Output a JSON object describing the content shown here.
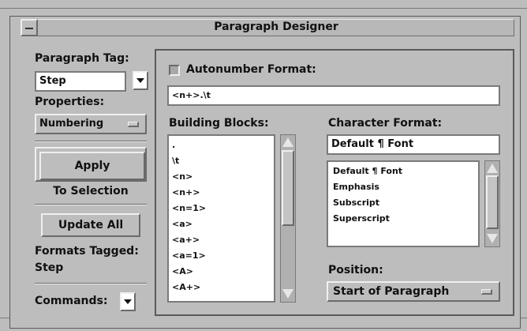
{
  "window": {
    "title": "Paragraph Designer"
  },
  "left": {
    "paragraph_tag_label": "Paragraph Tag:",
    "paragraph_tag_value": "Step",
    "properties_label": "Properties:",
    "properties_value": "Numbering",
    "apply_label": "Apply",
    "to_selection_label": "To Selection",
    "update_all_label": "Update All",
    "formats_tagged_label": "Formats Tagged:",
    "formats_tagged_value": "Step",
    "commands_label": "Commands:"
  },
  "numbering": {
    "autonumber_label": "Autonumber Format:",
    "autonumber_value": "<n+>.\\t",
    "building_blocks_label": "Building Blocks:",
    "building_blocks": [
      ".",
      "\\t",
      "<n>",
      "<n+>",
      "<n=1>",
      "<a>",
      "<a+>",
      "<a=1>",
      "<A>",
      "<A+>"
    ],
    "character_format_label": "Character Format:",
    "character_format_value": "Default ¶ Font",
    "character_formats": [
      "Default ¶ Font",
      "Emphasis",
      "Subscript",
      "Superscript"
    ],
    "position_label": "Position:",
    "position_value": "Start of Paragraph"
  },
  "icons": {
    "window_menu": "window-menu-icon",
    "dropdown": "down-arrow-icon",
    "scroll_up": "up-triangle-icon",
    "scroll_down": "down-triangle-icon",
    "option_menu": "option-menu-indicator-icon",
    "checkbox": "checkbox-icon"
  },
  "colors": {
    "background": "#bdbdbd",
    "field": "#ffffff",
    "text": "#111111"
  }
}
